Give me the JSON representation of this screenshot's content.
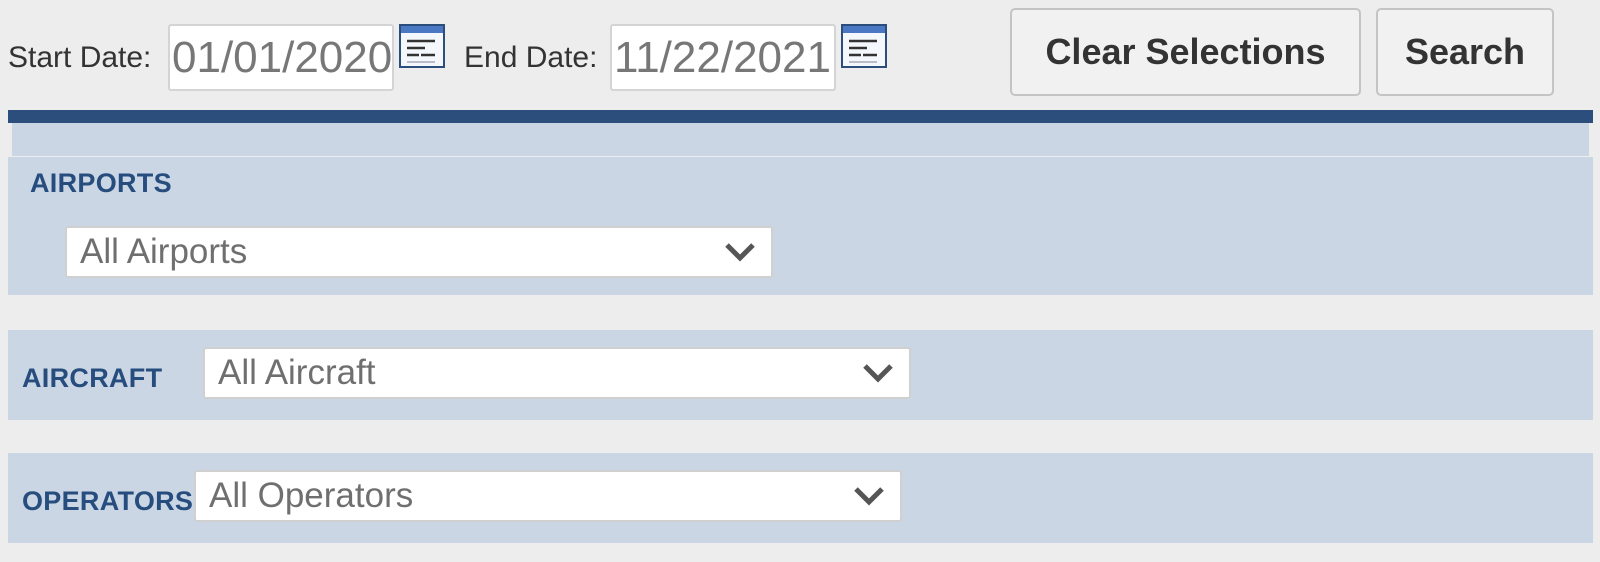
{
  "date_range": {
    "start_label": "Start Date:",
    "start_value": "01/01/2020",
    "end_label": "End Date:",
    "end_value": "11/22/2021"
  },
  "actions": {
    "clear_label": "Clear Selections",
    "search_label": "Search"
  },
  "filters": {
    "airports": {
      "label": "AIRPORTS",
      "selected": "All Airports"
    },
    "aircraft": {
      "label": "AIRCRAFT",
      "selected": "All Aircraft"
    },
    "operators": {
      "label": "OPERATORS",
      "selected": "All Operators"
    }
  },
  "icons": {
    "calendar": "calendar-icon",
    "dropdown": "chevron-down-icon"
  },
  "colors": {
    "page_background": "#ededed",
    "header_bar": "#2b4e7d",
    "panel_background": "#cad6e4",
    "section_label": "#264d7e"
  }
}
